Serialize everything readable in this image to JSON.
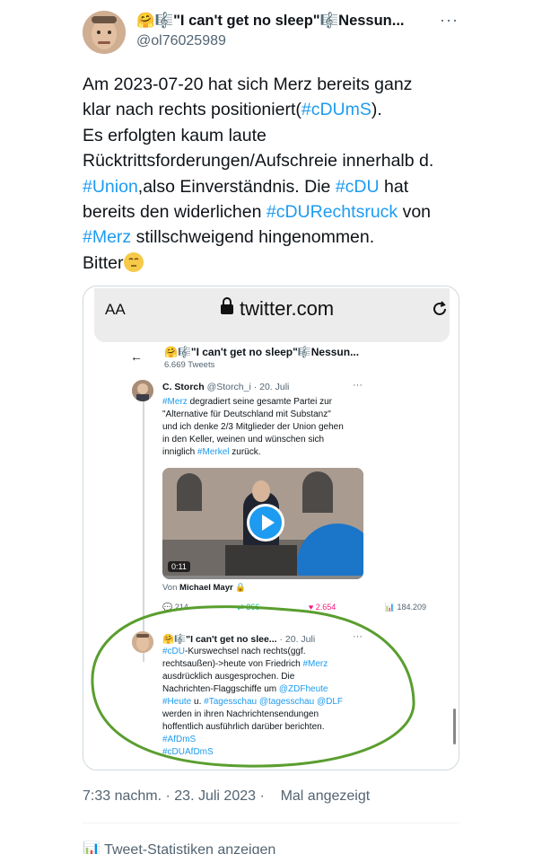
{
  "author": {
    "display_name": "🤗🎼\"I can't get no sleep\"🎼Nessun...",
    "handle": "@ol76025989",
    "more_label": "···"
  },
  "tweet": {
    "lines": [
      [
        "Am 2023-07-20 hat sich Merz bereits ganz"
      ],
      [
        "klar nach rechts positioniert(",
        "#cDUmS",
        ")."
      ],
      [
        "Es erfolgten kaum laute"
      ],
      [
        "Rücktrittsforderungen/Aufschreie innerhalb d."
      ],
      [
        "#Union",
        ",also Einverständnis. Die ",
        "#cDU",
        " hat"
      ],
      [
        "bereits den widerlichen  ",
        "#cDURechtsruck",
        " von"
      ],
      [
        "#Merz",
        " stillschweigend hingenommen."
      ],
      [
        "Bitter"
      ]
    ],
    "timestamp": "7:33 nachm. · 23. Juli 2023 ·",
    "views": "Mal angezeigt"
  },
  "browser": {
    "aa": "AA",
    "url": "twitter.com"
  },
  "embedded": {
    "header_name": "🤗🎼\"I can't get no sleep\"🎼Nessun...",
    "header_sub": "6.669 Tweets",
    "tweet1": {
      "name": "C. Storch",
      "meta": "@Storch_i · 20. Juli",
      "lines": [
        "#Merz degradiert seine gesamte Partei zur",
        "\"Alternative für Deutschland mit Substanz\"",
        "und ich denke 2/3 Mitglieder der Union gehen",
        "in den Keller, weinen und wünschen sich",
        "inniglich #Merkel zurück."
      ],
      "video_time": "0:11",
      "from_label": "Von",
      "from_name": "Michael Mayr",
      "replies": "214",
      "retweets": "366",
      "likes": "2.654",
      "views": "184.209"
    },
    "tweet2": {
      "name": "🤗🎼\"I can't get no slee...",
      "meta": "· 20. Juli",
      "lines": [
        "#cDU-Kurswechsel nach rechts(ggf.",
        "rechtsaußen)->heute von Friedrich #Merz",
        "ausdrücklich ausgesprochen. Die",
        "Nachrichten-Flaggschiffe um @ZDFheute",
        "#Heute u. #Tagesschau @tagesschau @DLF",
        "werden in ihren Nachrichtensendungen",
        "hoffentlich ausführlich darüber berichten.",
        "#AfDmS",
        "#cDUAfDmS"
      ]
    }
  },
  "footer": {
    "stats_label": "Tweet-Statistiken anzeigen"
  },
  "colors": {
    "link": "#1d9bf0",
    "muted": "#536471",
    "annotation_green": "#5a9e2f"
  }
}
